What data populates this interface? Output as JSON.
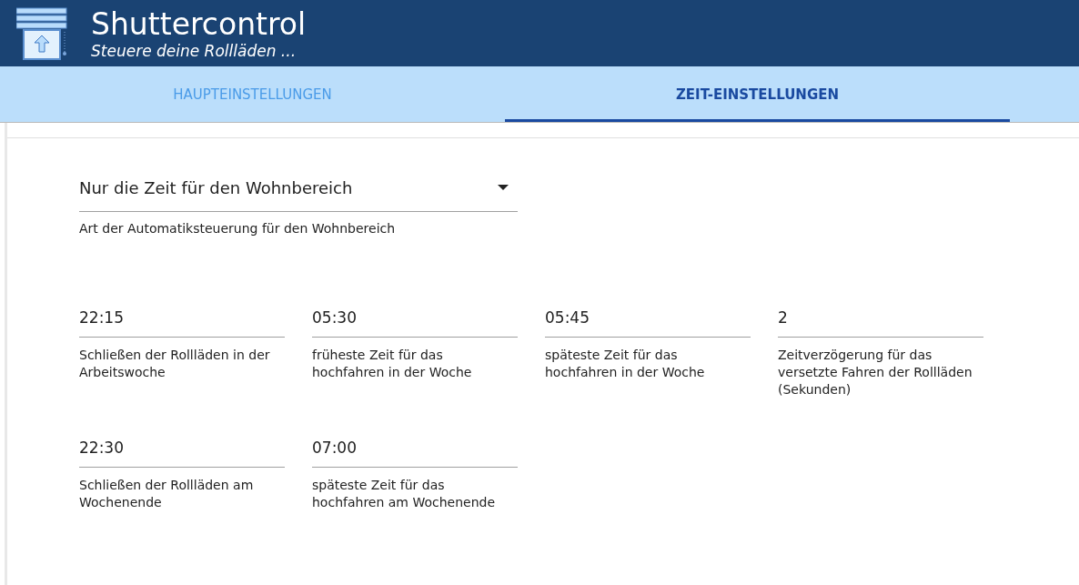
{
  "header": {
    "title": "Shuttercontrol",
    "subtitle": "Steuere deine Rollläden ..."
  },
  "tabs": [
    {
      "label": "HAUPTEINSTELLUNGEN",
      "selected": false
    },
    {
      "label": "ZEIT-EINSTELLUNGEN",
      "selected": true
    }
  ],
  "mode_select": {
    "value": "Nur die Zeit für den Wohnbereich",
    "helper": "Art der Automatiksteuerung für den Wohnbereich"
  },
  "fields": [
    {
      "value": "22:15",
      "label": "Schließen der Rollläden in der Arbeitswoche"
    },
    {
      "value": "05:30",
      "label": "früheste Zeit für das hochfahren in der Woche"
    },
    {
      "value": "05:45",
      "label": "späteste Zeit für das hochfahren in der Woche"
    },
    {
      "value": "2",
      "label": "Zeitverzögerung für das versetzte Fahren der Rollläden (Sekunden)"
    },
    {
      "value": "22:30",
      "label": "Schließen der Rollläden am Wochenende"
    },
    {
      "value": "07:00",
      "label": "späteste Zeit für das hochfahren am Wochenende"
    }
  ]
}
